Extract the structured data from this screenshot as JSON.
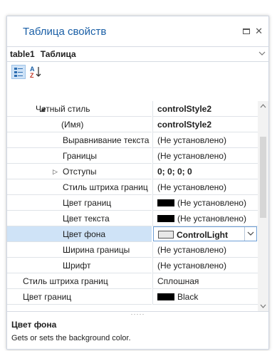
{
  "window": {
    "title": "Таблица свойств",
    "restore_icon": "restore-icon",
    "close_glyph": "✕"
  },
  "object_selector": {
    "name": "table1",
    "type": "Таблица"
  },
  "toolbar": {
    "categorized_icon": "categorized-icon",
    "alphabetical_glyph_a": "A",
    "alphabetical_glyph_z": "Z"
  },
  "grid": {
    "rows": [
      {
        "label": "Четный стиль",
        "value": "controlStyle2",
        "bold": true,
        "expander": "◢",
        "indent": 1
      },
      {
        "label": "(Имя)",
        "value": "controlStyle2",
        "bold": true,
        "indent": 2
      },
      {
        "label": "Выравнивание текста",
        "value": "(Не установлено)",
        "indent": 2
      },
      {
        "label": "Границы",
        "value": "(Не установлено)",
        "indent": 2
      },
      {
        "label": "Отступы",
        "value": "0; 0; 0; 0",
        "bold": true,
        "expander": "▷",
        "indent": 2
      },
      {
        "label": "Стиль штриха границ",
        "value": "(Не установлено)",
        "indent": 2
      },
      {
        "label": "Цвет границ",
        "value": "(Не установлено)",
        "swatch": "#000000",
        "indent": 2
      },
      {
        "label": "Цвет текста",
        "value": "(Не установлено)",
        "swatch": "#000000",
        "indent": 2
      },
      {
        "label": "Цвет фона",
        "value": "ControlLight",
        "bold": true,
        "swatch": "#e8e8e8",
        "selected": true,
        "indent": 2
      },
      {
        "label": "Ширина границы",
        "value": "(Не установлено)",
        "indent": 2
      },
      {
        "label": "Шрифт",
        "value": "(Не установлено)",
        "indent": 2
      },
      {
        "label": "Стиль штриха границ",
        "value": "Сплошная",
        "indent": 0
      },
      {
        "label": "Цвет границ",
        "value": "Black",
        "swatch": "#000000",
        "indent": 0
      }
    ]
  },
  "splitter_dots": "·····",
  "description": {
    "title": "Цвет фона",
    "text": "Gets or sets the background color."
  },
  "colors": {
    "title_blue": "#1a5fa6",
    "selection": "#cfe3f7"
  }
}
